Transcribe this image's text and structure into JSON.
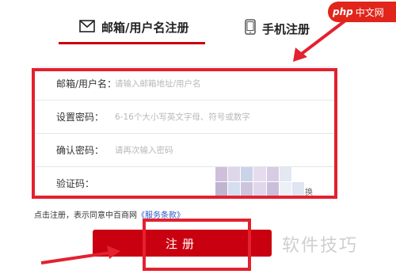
{
  "tabs": {
    "email": {
      "label": "邮箱/用户名注册",
      "icon": "mail-icon"
    },
    "phone": {
      "label": "手机注册",
      "icon": "phone-icon"
    }
  },
  "form": {
    "fields": [
      {
        "label": "邮箱/用户名：",
        "placeholder": "请输入邮箱地址/用户名"
      },
      {
        "label": "设置密码：",
        "placeholder": "6-16个大小写英文字母、符号或数字"
      },
      {
        "label": "确认密码：",
        "placeholder": "请再次输入密码"
      },
      {
        "label": "验证码：",
        "placeholder": ""
      }
    ],
    "captcha_refresh": "换"
  },
  "agreement": {
    "text": "点击注册，表示同意中百商网",
    "link": "《服务条款》"
  },
  "register_button": {
    "label": "注册"
  },
  "watermark": {
    "php_logo_prefix": "php",
    "php_logo_text": "中文网",
    "caption": "软件技巧"
  },
  "colors": {
    "brand_red": "#c9000f",
    "highlight_red": "#e3212f",
    "link_blue": "#2a56c6"
  }
}
